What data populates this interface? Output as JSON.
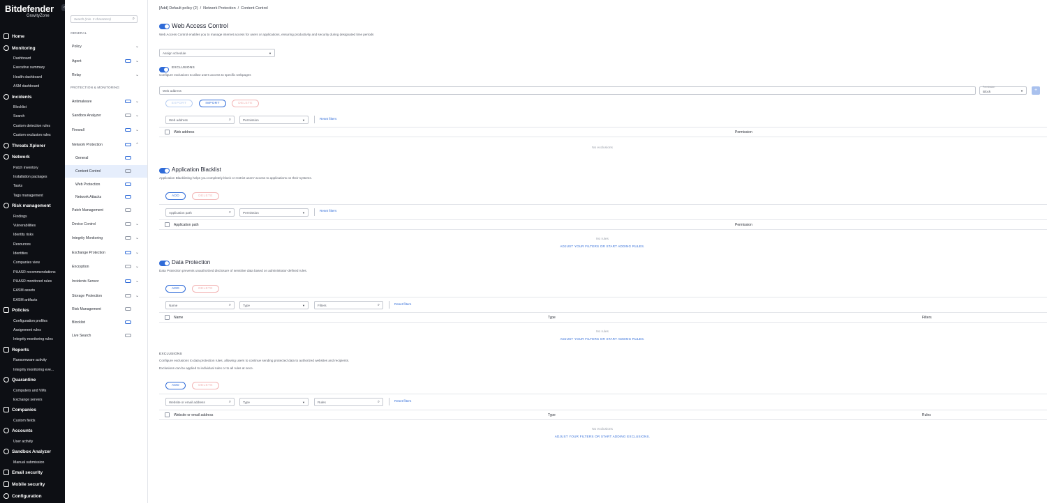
{
  "nav": {
    "brand": "Bitdefender",
    "brand_sub": "GravityZone",
    "items": [
      {
        "label": "Home",
        "icon": "home-icon"
      },
      {
        "label": "Monitoring",
        "icon": "monitoring-icon"
      },
      {
        "label": "Dashboard"
      },
      {
        "label": "Executive summary"
      },
      {
        "label": "Health dashboard"
      },
      {
        "label": "ASM dashboard"
      },
      {
        "label": "Incidents",
        "icon": "incidents-icon"
      },
      {
        "label": "Blocklist"
      },
      {
        "label": "Search"
      },
      {
        "label": "Custom detection rules"
      },
      {
        "label": "Custom exclusion rules"
      },
      {
        "label": "Threats Xplorer",
        "icon": "threats-icon"
      },
      {
        "label": "Network",
        "icon": "network-icon"
      },
      {
        "label": "Patch inventory"
      },
      {
        "label": "Installation packages"
      },
      {
        "label": "Tasks"
      },
      {
        "label": "Tags management"
      },
      {
        "label": "Risk management",
        "icon": "risk-icon"
      },
      {
        "label": "Findings"
      },
      {
        "label": "Vulnerabilities"
      },
      {
        "label": "Identity risks"
      },
      {
        "label": "Resources"
      },
      {
        "label": "Identities"
      },
      {
        "label": "Companies view"
      },
      {
        "label": "PHASR recommendations"
      },
      {
        "label": "PHASR monitored rules"
      },
      {
        "label": "EASM assets"
      },
      {
        "label": "EASM artifacts"
      },
      {
        "label": "Policies",
        "icon": "policies-icon"
      },
      {
        "label": "Configuration profiles"
      },
      {
        "label": "Assignment rules"
      },
      {
        "label": "Integrity monitoring rules"
      },
      {
        "label": "Reports",
        "icon": "reports-icon"
      },
      {
        "label": "Ransomware activity"
      },
      {
        "label": "Integrity monitoring eve..."
      },
      {
        "label": "Quarantine",
        "icon": "quarantine-icon"
      },
      {
        "label": "Computers and VMs"
      },
      {
        "label": "Exchange servers"
      },
      {
        "label": "Companies",
        "icon": "companies-icon"
      },
      {
        "label": "Custom fields"
      },
      {
        "label": "Accounts",
        "icon": "accounts-icon"
      },
      {
        "label": "User activity"
      },
      {
        "label": "Sandbox Analyzer",
        "icon": "sandbox-icon"
      },
      {
        "label": "Manual submission"
      },
      {
        "label": "Email security",
        "icon": "email-icon"
      },
      {
        "label": "Mobile security",
        "icon": "mobile-icon"
      },
      {
        "label": "Configuration",
        "icon": "configuration-icon"
      }
    ]
  },
  "side": {
    "search_placeholder": "Search (min. 3 characters)",
    "general_header": "GENERAL",
    "protection_header": "PROTECTION & MONITORING",
    "items": [
      {
        "label": "Policy"
      },
      {
        "label": "Agent"
      },
      {
        "label": "Relay"
      },
      {
        "label": "Antimalware"
      },
      {
        "label": "Sandbox Analyzer"
      },
      {
        "label": "Firewall"
      },
      {
        "label": "Network Protection"
      },
      {
        "label": "General"
      },
      {
        "label": "Content Control"
      },
      {
        "label": "Web Protection"
      },
      {
        "label": "Network Attacks"
      },
      {
        "label": "Patch Management"
      },
      {
        "label": "Device Control"
      },
      {
        "label": "Integrity Monitoring"
      },
      {
        "label": "Exchange Protection"
      },
      {
        "label": "Encryption"
      },
      {
        "label": "Incidents Sensor"
      },
      {
        "label": "Storage Protection"
      },
      {
        "label": "Risk Management"
      },
      {
        "label": "Blocklist"
      },
      {
        "label": "Live Search"
      }
    ]
  },
  "breadcrumb": {
    "part1": "[Add] Default policy (2)",
    "part2": "Network Protection",
    "part3": "Content Control",
    "sep": "/"
  },
  "wac": {
    "title": "Web Access Control",
    "desc": "Web Access Control enables you to manage internet access for users or applications, ensuring productivity and security during designated time periods",
    "schedule": "Assign schedule",
    "exclusions_label": "EXCLUSIONS",
    "exclusions_desc": "Configure exclusions to allow users access to specific webpages",
    "web_address_placeholder": "Web address",
    "permission_label": "Permission",
    "permission_value": "Block",
    "export": "EXPORT",
    "import": "IMPORT",
    "delete": "DELETE",
    "filter_web": "Web address",
    "filter_perm": "Permission",
    "reset": "Reset filters",
    "col_web": "Web address",
    "col_perm": "Permission",
    "empty": "No exclusions"
  },
  "ab": {
    "title": "Application Blacklist",
    "desc": "Application Blacklisting helps you completely block or restrict users' access to applications on their systems.",
    "add": "ADD",
    "delete": "DELETE",
    "filter_path": "Application path",
    "filter_perm": "Permission",
    "reset": "Reset filters",
    "col_path": "Application path",
    "col_perm": "Permission",
    "empty": "No rules",
    "empty_link": "ADJUST YOUR FILTERS OR START ADDING RULES."
  },
  "dp": {
    "title": "Data Protection",
    "desc": "Data Protection prevents unauthorized disclosure of sensitive data based on administrator-defined rules.",
    "add": "ADD",
    "delete": "DELETE",
    "filter_name": "Name",
    "filter_type": "Type",
    "filter_filters": "Filters",
    "reset": "Reset filters",
    "col_name": "Name",
    "col_type": "Type",
    "col_filters": "Filters",
    "empty": "No rules",
    "empty_link": "ADJUST YOUR FILTERS OR START ADDING RULES."
  },
  "dpex": {
    "label": "EXCLUSIONS",
    "desc1": "Configure exclusions to data protection rules, allowing users to continue sending protected data to authorized websites and recipients.",
    "desc2": "Exclusions can be applied to individual rules or to all rules at once.",
    "add": "ADD",
    "delete": "DELETE",
    "filter_web": "Website or email address",
    "filter_type": "Type",
    "filter_rules": "Rules",
    "reset": "Reset filters",
    "col_web": "Website or email address",
    "col_type": "Type",
    "col_rules": "Rules",
    "empty": "No exclusions",
    "empty_link": "ADJUST YOUR FILTERS OR START ADDING EXCLUSIONS."
  },
  "colors": {
    "accent": "#2f6bd8",
    "nav_bg": "#0d0f14",
    "active_bg": "#e6eefc"
  }
}
